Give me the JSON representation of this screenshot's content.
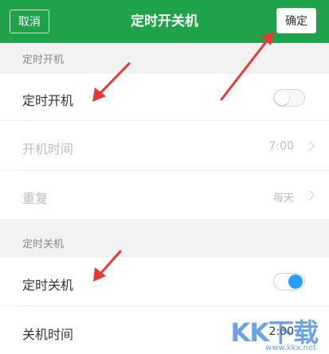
{
  "header": {
    "cancel_label": "取消",
    "title": "定时开关机",
    "confirm_label": "确定",
    "bg_color": "#1fa24a"
  },
  "power_on": {
    "section_label": "定时开机",
    "toggle_label": "定时开机",
    "toggle_on": false,
    "time_label": "开机时间",
    "time_value": "7:00",
    "repeat_label": "重复",
    "repeat_value": "每天"
  },
  "power_off": {
    "section_label": "定时关机",
    "toggle_label": "定时关机",
    "toggle_on": true,
    "time_label": "关机时间",
    "time_value": "2:00"
  },
  "watermark": {
    "logo_text": "KK下载",
    "url_text": "www.kkx.net"
  },
  "accent_colors": {
    "toggle_active": "#2a9df4",
    "annotation_arrow": "#e53935"
  }
}
